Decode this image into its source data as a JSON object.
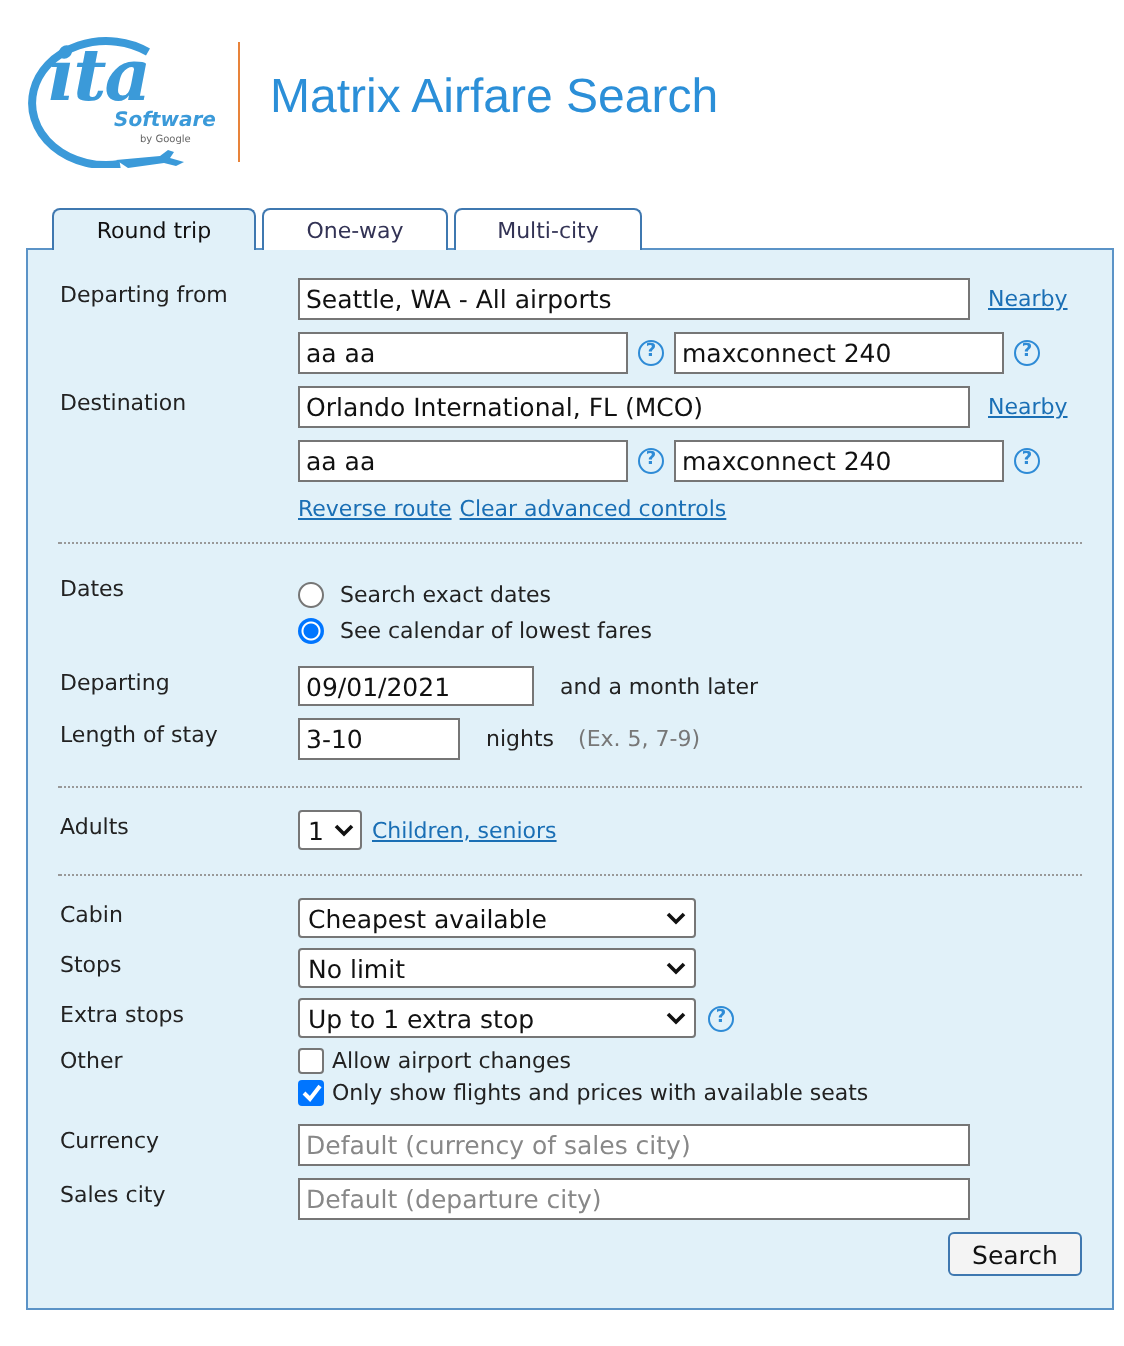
{
  "header": {
    "logo": {
      "mark": "ita",
      "name": "Software",
      "byline": "by Google"
    },
    "title": "Matrix Airfare Search"
  },
  "tabs": [
    {
      "label": "Round trip",
      "selected": true
    },
    {
      "label": "One-way",
      "selected": false
    },
    {
      "label": "Multi-city",
      "selected": false
    }
  ],
  "form": {
    "origin": {
      "label": "Departing from",
      "airport": "Seattle, WA - All airports",
      "nearby": "Nearby",
      "routing": {
        "value": "aa aa",
        "help": "?"
      },
      "extension": {
        "value": "maxconnect 240",
        "help": "?"
      }
    },
    "destination": {
      "label": "Destination",
      "airport": "Orlando International, FL (MCO)",
      "nearby": "Nearby",
      "routing": {
        "value": "aa aa",
        "help": "?"
      },
      "extension": {
        "value": "maxconnect 240",
        "help": "?"
      }
    },
    "route_links": [
      "Reverse route",
      "Clear advanced controls"
    ],
    "dates": {
      "label": "Dates",
      "options": [
        {
          "label": "Search exact dates",
          "selected": false
        },
        {
          "label": "See calendar of lowest fares",
          "selected": true
        }
      ]
    },
    "departing": {
      "label": "Departing",
      "value": "09/01/2021",
      "note": "and a month later"
    },
    "stay": {
      "label": "Length of stay",
      "value": "3-10",
      "unit": "nights",
      "hint": "(Ex. 5, 7-9)"
    },
    "adults": {
      "label": "Adults",
      "value": "1",
      "link": "Children, seniors"
    },
    "options": [
      {
        "label": "Cabin",
        "value": "Cheapest available"
      },
      {
        "label": "Stops",
        "value": "No limit"
      },
      {
        "label": "Extra stops",
        "value": "Up to 1 extra stop",
        "help": "?"
      }
    ],
    "other": {
      "label": "Other",
      "options": [
        {
          "label": "Allow airport changes",
          "checked": false
        },
        {
          "label": "Only show flights and prices with available seats",
          "checked": true
        }
      ]
    },
    "settings": [
      {
        "label": "Currency",
        "placeholder": "Default (currency of sales city)"
      },
      {
        "label": "Sales city",
        "placeholder": "Default (departure city)"
      }
    ],
    "submit": "Search"
  }
}
